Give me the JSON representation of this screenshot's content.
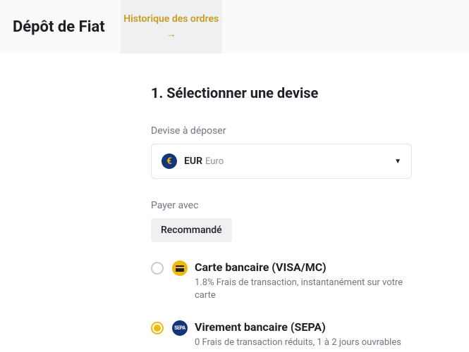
{
  "header": {
    "title": "Dépôt de Fiat",
    "order_history": "Historique des ordres"
  },
  "step": {
    "title": "1. Sélectionner une devise"
  },
  "currency": {
    "label": "Devise à déposer",
    "symbol": "€",
    "code": "EUR",
    "name": "Euro"
  },
  "pay_with": {
    "label": "Payer avec",
    "chip": "Recommandé"
  },
  "methods": {
    "card": {
      "title": "Carte bancaire (VISA/MC)",
      "desc": "1.8% Frais de transaction, instantanément sur votre carte",
      "selected": false
    },
    "sepa": {
      "title": "Virement bancaire (SEPA)",
      "desc": "0 Frais de transaction réduits, 1 à 2 jours ouvrables",
      "badge": "SEPA",
      "selected": true
    }
  }
}
